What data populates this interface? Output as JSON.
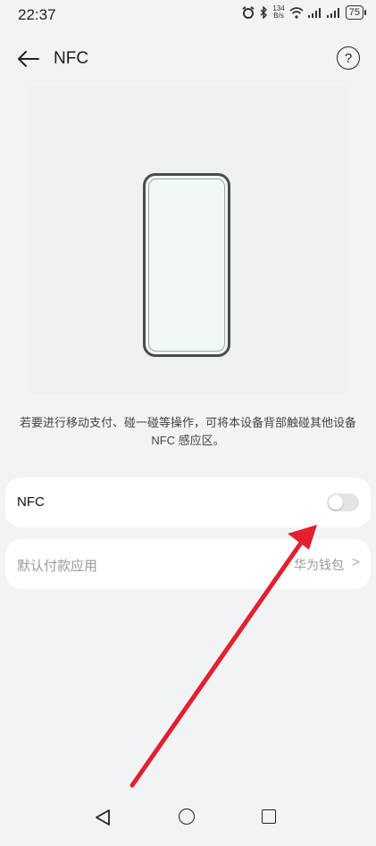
{
  "status_bar": {
    "time": "22:37",
    "net_speed_value": "134",
    "net_speed_unit": "B/s",
    "battery": "75"
  },
  "header": {
    "title": "NFC",
    "help_symbol": "?"
  },
  "description": "若要进行移动支付、碰一碰等操作，可将本设备背部触碰其他设备 NFC 感应区。",
  "settings": {
    "nfc_label": "NFC",
    "nfc_enabled": false,
    "default_pay_label": "默认付款应用",
    "default_pay_value": "华为钱包",
    "chevron": ">"
  },
  "colors": {
    "annotation_arrow": "#e3202e",
    "toggle_off": "#e2e4e7"
  }
}
